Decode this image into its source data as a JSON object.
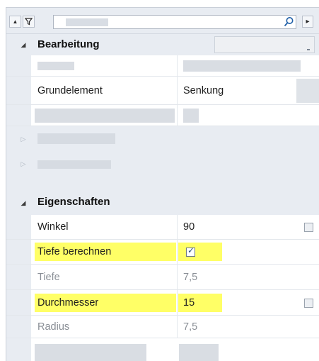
{
  "toolbar": {
    "collapse_icon": "chevron-up-icon",
    "filter_icon": "funnel-icon",
    "search_icon": "magnifier-icon",
    "more_icon": "triangle-right-icon",
    "glyphs": {
      "collapse": "▲",
      "filter": "⏷",
      "more": "▸"
    }
  },
  "categories": {
    "bearbeitung": {
      "label": "Bearbeitung",
      "arrow": "◢"
    },
    "eigenschaften": {
      "label": "Eigenschaften",
      "arrow": "◢"
    },
    "collapsed_arrow": "▷"
  },
  "bearbeitung": {
    "grundelement": {
      "name": "Grundelement",
      "value": "Senkung"
    }
  },
  "eigenschaften": {
    "winkel": {
      "name": "Winkel",
      "value": "90",
      "checked": false
    },
    "tiefe_berechnen": {
      "name": "Tiefe berechnen",
      "checked": true
    },
    "tiefe": {
      "name": "Tiefe",
      "value": "7,5"
    },
    "durchmesser": {
      "name": "Durchmesser",
      "value": "15",
      "checked": false
    },
    "radius": {
      "name": "Radius",
      "value": "7,5"
    }
  },
  "colors": {
    "highlight": "#ffff66",
    "category_bg": "#e8ecf2",
    "placeholder": "#d9dde3",
    "muted_text": "#8a8f96"
  },
  "check_glyph": "✓"
}
